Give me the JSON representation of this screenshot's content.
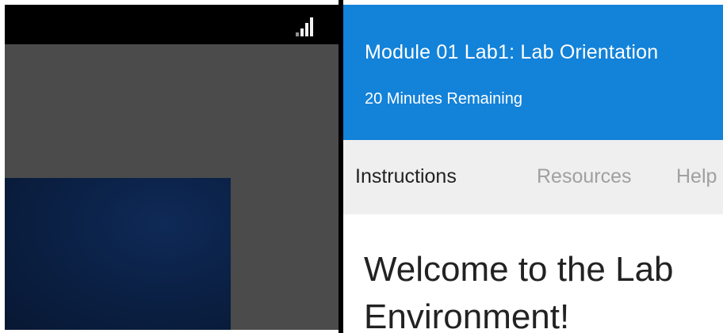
{
  "vm": {
    "status_icon": "signal-strength-icon",
    "desktop_color": "#0a1f42"
  },
  "lab": {
    "title": "Module 01 Lab1: Lab Orientation",
    "time_remaining": "20 Minutes Remaining",
    "header_color": "#1382d9",
    "tabs": [
      {
        "label": "Instructions",
        "active": true
      },
      {
        "label": "Resources",
        "active": false
      },
      {
        "label": "Help",
        "active": false
      }
    ],
    "content": {
      "heading": "Welcome to the Lab Environment!"
    }
  }
}
